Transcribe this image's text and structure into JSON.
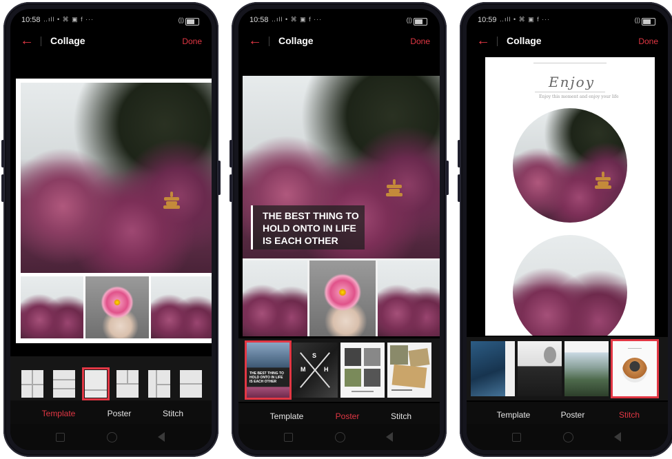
{
  "phones": [
    {
      "status": {
        "time": "10:58",
        "icons": "‥ıll • ⌘ ▣ f ···"
      },
      "header": {
        "back_icon": "back-arrow-icon",
        "title": "Collage",
        "done_label": "Done"
      },
      "tabs": [
        {
          "label": "Template"
        },
        {
          "label": "Poster"
        },
        {
          "label": "Stitch"
        }
      ],
      "active_tab": "Template"
    },
    {
      "status": {
        "time": "10:58",
        "icons": "‥ıll • ⌘ ▣ f ···"
      },
      "header": {
        "back_icon": "back-arrow-icon",
        "title": "Collage",
        "done_label": "Done"
      },
      "caption": {
        "lines": [
          "THE BEST THING TO",
          "HOLD ONTO IN LIFE",
          "IS EACH OTHER"
        ]
      },
      "poster_thumb_text": {
        "mini_caption": [
          "THE BEST THING TO",
          "HOLD ONTO IN LIFE",
          "IS EACH OTHER"
        ],
        "letters": [
          "S",
          "M",
          "H"
        ]
      },
      "tabs": [
        {
          "label": "Template"
        },
        {
          "label": "Poster"
        },
        {
          "label": "Stitch"
        }
      ],
      "active_tab": "Poster"
    },
    {
      "status": {
        "time": "10:59",
        "icons": "‥ıll • ⌘ ▣ f ···"
      },
      "header": {
        "back_icon": "back-arrow-icon",
        "title": "Collage",
        "done_label": "Done"
      },
      "stitch": {
        "heading": "Enjoy",
        "subtitle": "Enjoy this moment and enjoy your life"
      },
      "tabs": [
        {
          "label": "Template"
        },
        {
          "label": "Poster"
        },
        {
          "label": "Stitch"
        }
      ],
      "active_tab": "Stitch"
    }
  ],
  "colors": {
    "accent": "#e23744",
    "screen_bg": "#000000",
    "tab_text": "#e6e6e6"
  }
}
